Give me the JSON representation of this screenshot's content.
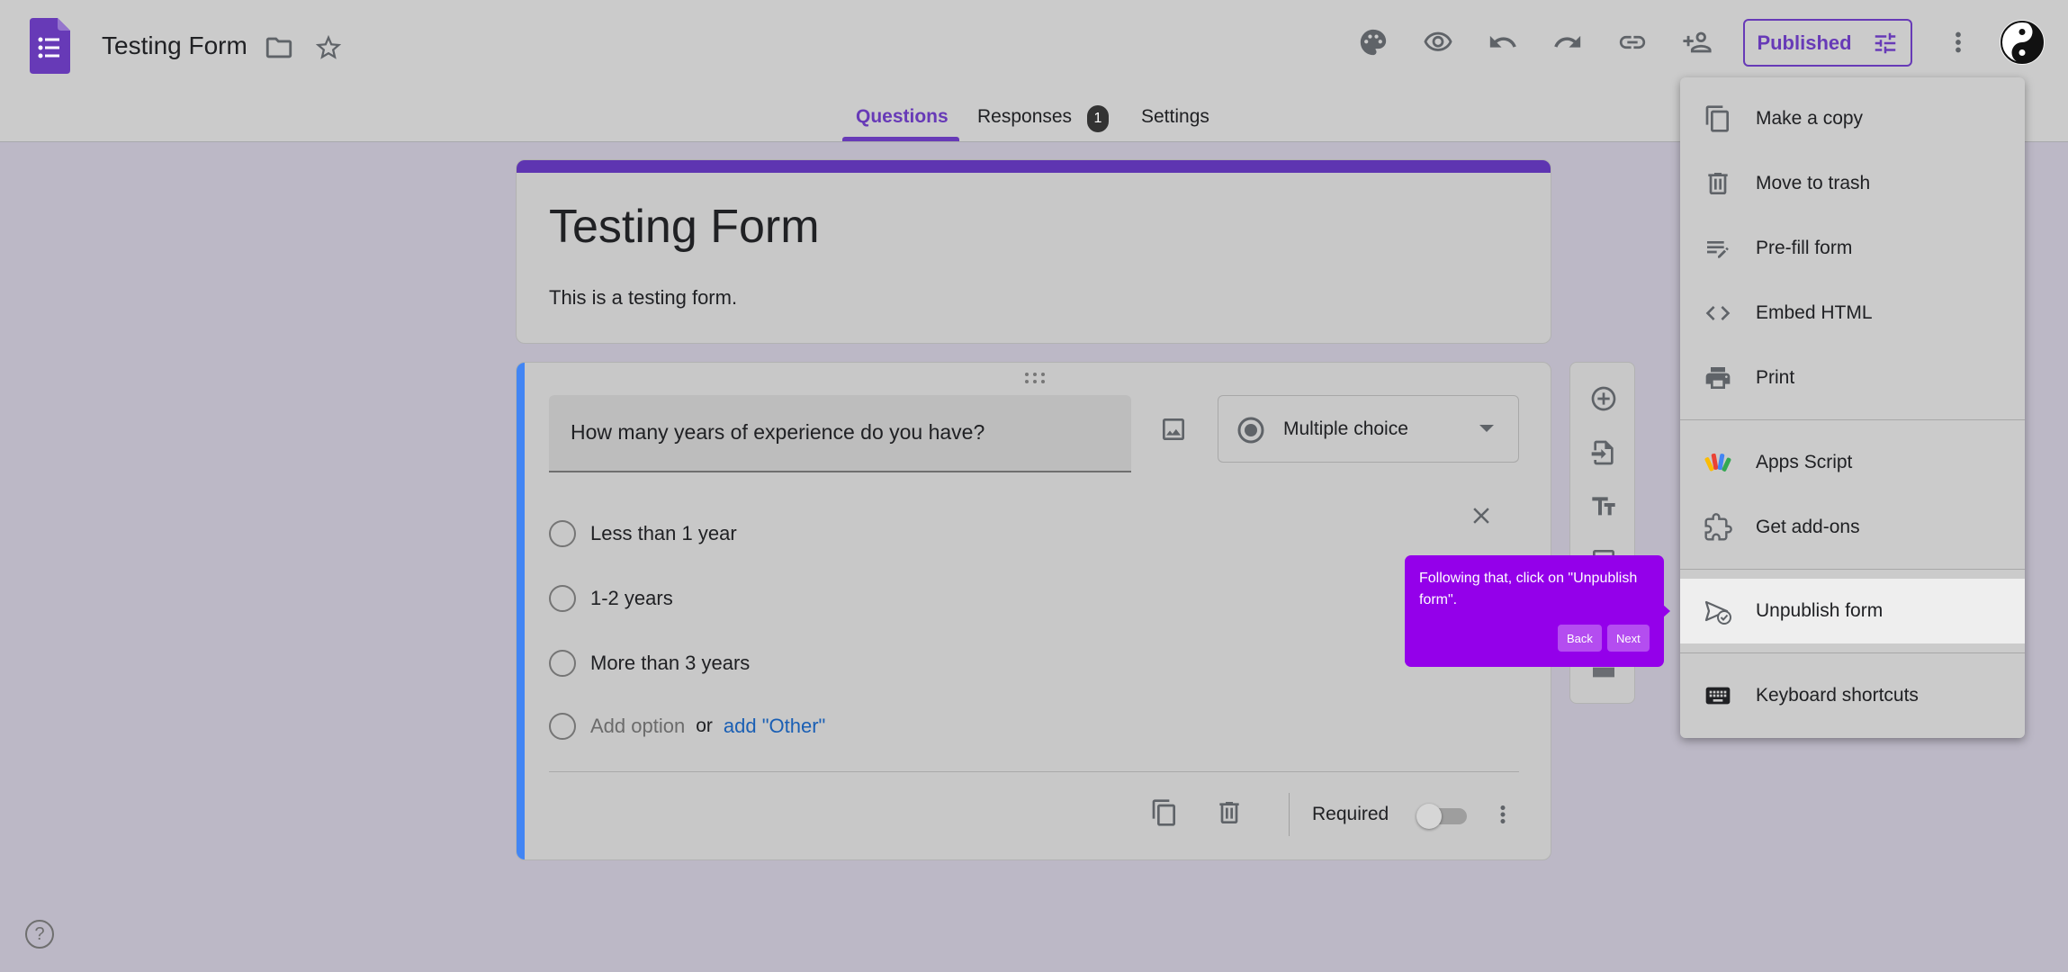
{
  "header": {
    "title": "Testing Form",
    "published_label": "Published"
  },
  "tabs": [
    {
      "label": "Questions",
      "active": true
    },
    {
      "label": "Responses",
      "badge": "1"
    },
    {
      "label": "Settings"
    }
  ],
  "form": {
    "title": "Testing Form",
    "description": "This is a testing form."
  },
  "question": {
    "text": "How many years of experience do you have?",
    "type": "Multiple choice",
    "options": [
      "Less than 1 year",
      "1-2 years",
      "More than 3 years"
    ],
    "add_option": "Add option",
    "or": "or",
    "add_other": "add \"Other\"",
    "required_label": "Required"
  },
  "tooltip": {
    "text": "Following that, click on \"Unpublish form\".",
    "back": "Back",
    "next": "Next"
  },
  "menu": {
    "items": [
      {
        "label": "Make a copy",
        "icon": "copy-icon"
      },
      {
        "label": "Move to trash",
        "icon": "trash-icon"
      },
      {
        "label": "Pre-fill form",
        "icon": "prefill-icon"
      },
      {
        "label": "Embed HTML",
        "icon": "code-icon"
      },
      {
        "label": "Print",
        "icon": "print-icon"
      },
      {
        "label": "Apps Script",
        "icon": "apps-script-icon"
      },
      {
        "label": "Get add-ons",
        "icon": "puzzle-icon"
      },
      {
        "label": "Unpublish form",
        "icon": "unpublish-icon",
        "highlighted": true
      },
      {
        "label": "Keyboard shortcuts",
        "icon": "keyboard-icon"
      }
    ]
  },
  "colors": {
    "accent": "#673ab7",
    "tooltip": "#9400ea",
    "question_bar": "#4285f4"
  }
}
